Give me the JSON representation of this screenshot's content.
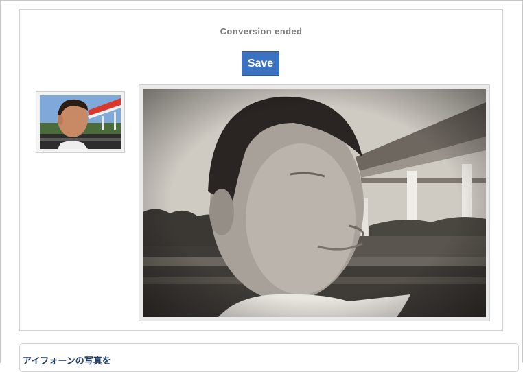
{
  "status_text": "Conversion ended",
  "save_button": {
    "label": "Save"
  },
  "thumbnail": {
    "alt": "Original photo thumbnail"
  },
  "result_image": {
    "alt": "Converted vintage photo"
  },
  "related": {
    "heading": "アイフォーンの写真を"
  },
  "colors": {
    "button_bg": "#3c72c2",
    "status_text": "#7b7b7b",
    "heading_text": "#1d3b63",
    "border": "#cfcfcf"
  }
}
